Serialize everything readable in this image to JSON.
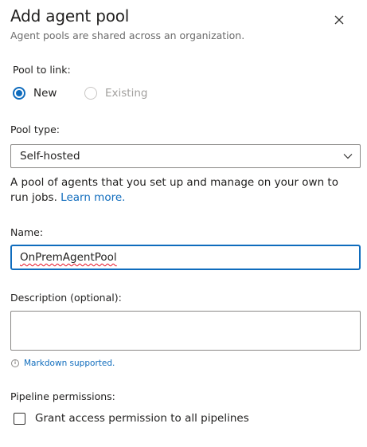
{
  "dialog": {
    "title": "Add agent pool",
    "subtitle": "Agent pools are shared across an organization."
  },
  "pool_link": {
    "label": "Pool to link:",
    "options": [
      {
        "label": "New",
        "selected": true,
        "enabled": true
      },
      {
        "label": "Existing",
        "selected": false,
        "enabled": false
      }
    ]
  },
  "pool_type": {
    "label": "Pool type:",
    "value": "Self-hosted"
  },
  "pool_type_description": {
    "text": "A pool of agents that you set up and manage on your own to run jobs.",
    "link": "Learn more."
  },
  "name": {
    "label": "Name:",
    "value": "OnPremAgentPool"
  },
  "description": {
    "label": "Description (optional):",
    "value": "",
    "hint": "Markdown supported."
  },
  "pipeline_permissions": {
    "label": "Pipeline permissions:",
    "checkbox_label": "Grant access permission to all pipelines",
    "checked": false
  },
  "colors": {
    "accent": "#0f6cbd",
    "text": "#201f1e",
    "muted": "#6b6b6b",
    "disabled": "#a19f9d",
    "border": "#8a8886"
  },
  "icons": {
    "close": "close-icon",
    "chevron": "chevron-down-icon",
    "info": "info-icon"
  }
}
